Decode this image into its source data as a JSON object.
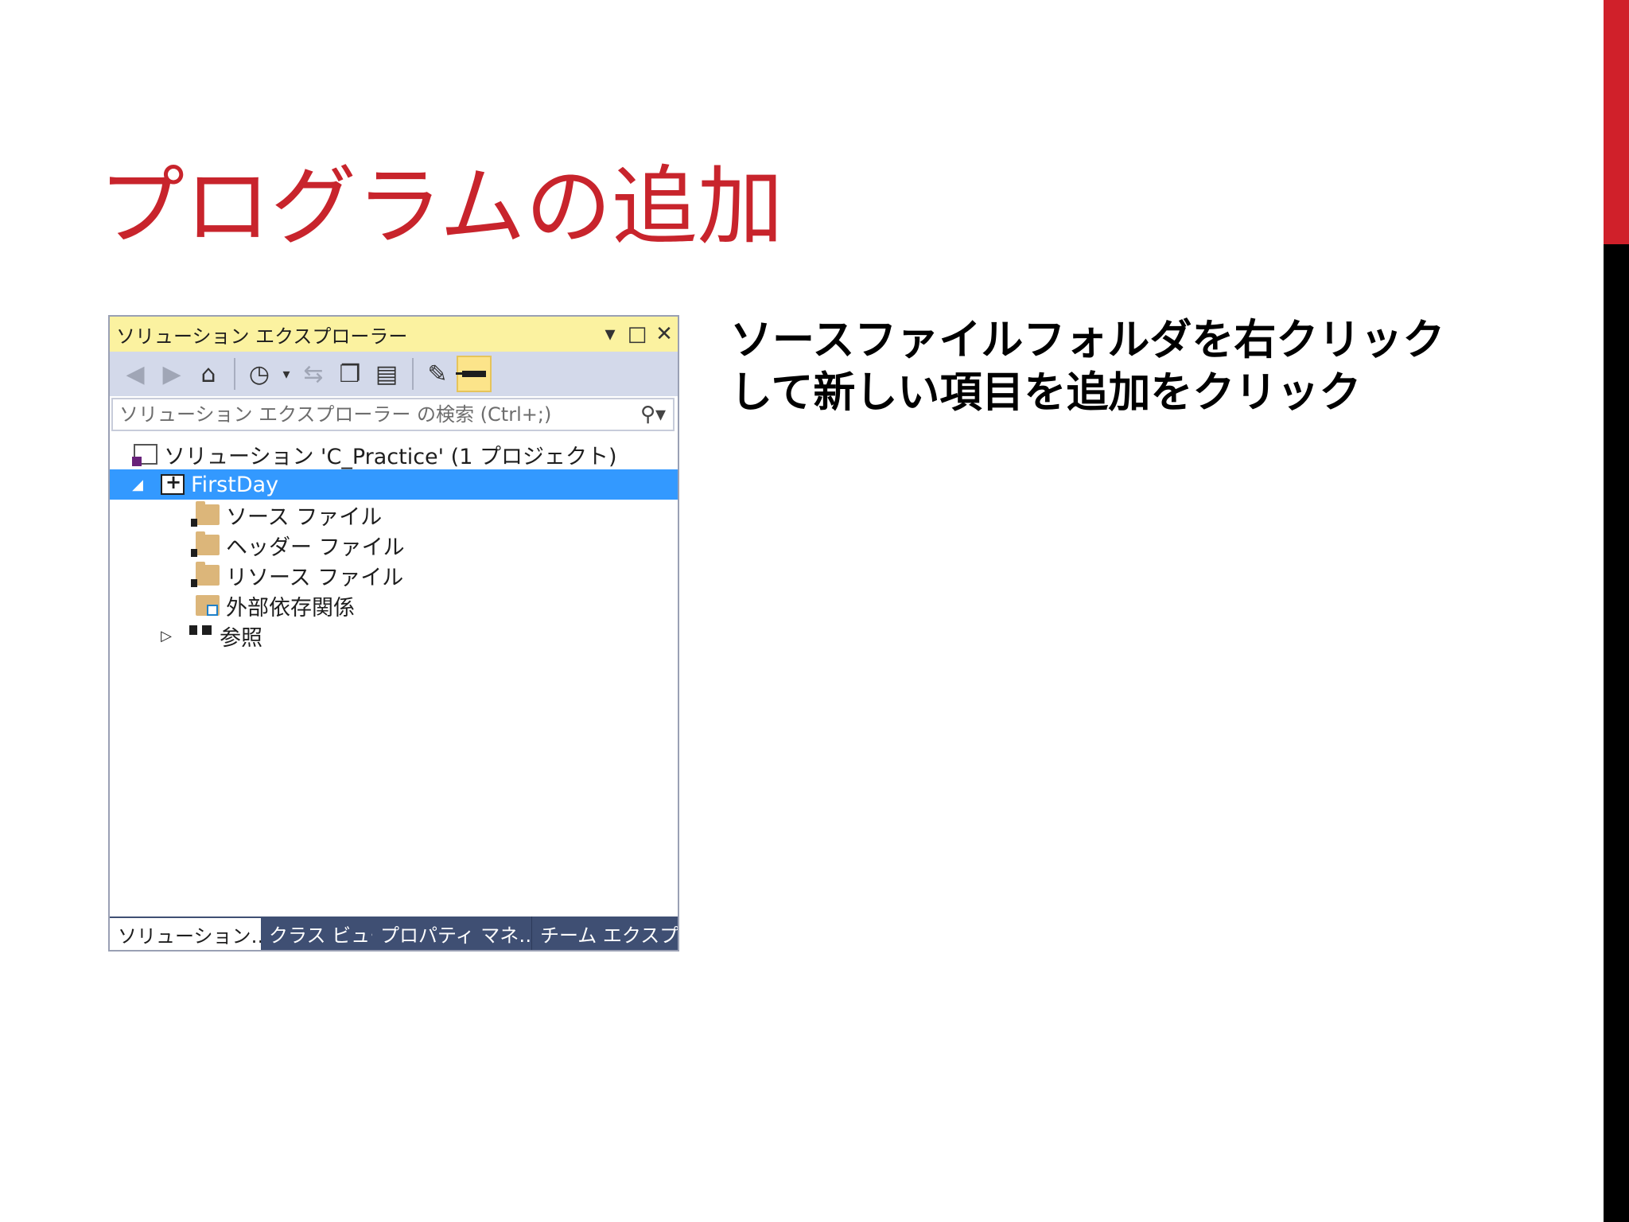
{
  "slide": {
    "title": "プログラムの追加",
    "instruction": "ソースファイルフォルダを右クリックして新しい項目を追加をクリック"
  },
  "explorer": {
    "title": "ソリューション エクスプローラー",
    "search_placeholder": "ソリューション エクスプローラー の検索 (Ctrl+;)",
    "tree": {
      "solution": "ソリューション 'C_Practice' (1 プロジェクト)",
      "project": "FirstDay",
      "source_files": "ソース ファイル",
      "header_files": "ヘッダー ファイル",
      "resource_files": "リソース ファイル",
      "external_deps": "外部依存関係",
      "references": "参照"
    },
    "tabs": {
      "solution": "ソリューション…",
      "class_view": "クラス ビュー",
      "property": "プロパティ マネ…",
      "team": "チーム エクスプ…"
    }
  },
  "colors": {
    "title_red": "#c8242c",
    "accent_red": "#d0202a",
    "selection_blue": "#3399ff",
    "titlebar_yellow": "#fbf2a0"
  }
}
